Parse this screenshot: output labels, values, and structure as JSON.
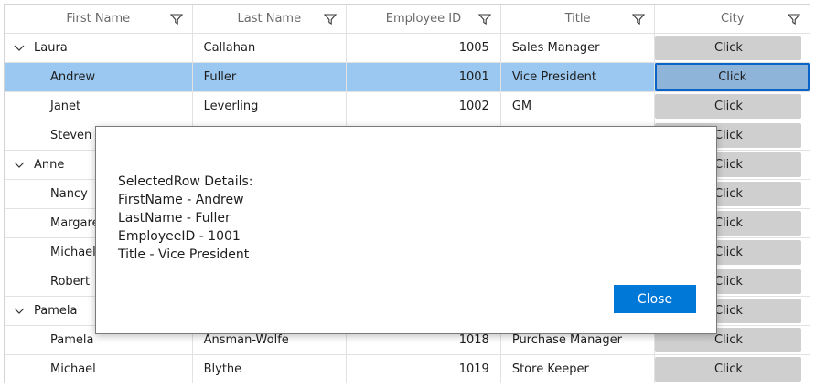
{
  "columns": [
    {
      "label": "First Name"
    },
    {
      "label": "Last Name"
    },
    {
      "label": "Employee ID"
    },
    {
      "label": "Title"
    },
    {
      "label": "City"
    }
  ],
  "rows": [
    {
      "type": "group",
      "first": "Laura",
      "last": "Callahan",
      "id": "1005",
      "title": "Sales Manager",
      "city": "Click"
    },
    {
      "type": "child",
      "first": "Andrew",
      "last": "Fuller",
      "id": "1001",
      "title": "Vice President",
      "city": "Click",
      "selected": true
    },
    {
      "type": "child",
      "first": "Janet",
      "last": "Leverling",
      "id": "1002",
      "title": "GM",
      "city": "Click"
    },
    {
      "type": "child",
      "first": "Steven",
      "last": "",
      "id": "",
      "title": "",
      "city": "Click"
    },
    {
      "type": "group",
      "first": "Anne",
      "last": "",
      "id": "",
      "title": "",
      "city": "Click"
    },
    {
      "type": "child",
      "first": "Nancy",
      "last": "",
      "id": "",
      "title": "",
      "city": "Click"
    },
    {
      "type": "child",
      "first": "Margaret",
      "last": "",
      "id": "",
      "title": "",
      "city": "Click"
    },
    {
      "type": "child",
      "first": "Michael",
      "last": "",
      "id": "",
      "title": "",
      "city": "Click"
    },
    {
      "type": "child",
      "first": "Robert",
      "last": "",
      "id": "",
      "title": "",
      "city": "Click"
    },
    {
      "type": "group",
      "first": "Pamela",
      "last": "",
      "id": "",
      "title": "",
      "city": "Click"
    },
    {
      "type": "child",
      "first": "Pamela",
      "last": "Ansman-Wolfe",
      "id": "1018",
      "title": "Purchase Manager",
      "city": "Click"
    },
    {
      "type": "child",
      "first": "Michael",
      "last": "Blythe",
      "id": "1019",
      "title": "Store Keeper",
      "city": "Click"
    }
  ],
  "dialog": {
    "lines": [
      "SelectedRow Details:",
      "FirstName - Andrew",
      "LastName - Fuller",
      "EmployeeID - 1001",
      "Title - Vice President"
    ],
    "close_label": "Close"
  },
  "colors": {
    "selected_row": "#9bc8f0",
    "accent": "#0078d7",
    "button_bg": "#cfcfcf"
  },
  "icons": {
    "filter": "filter-icon",
    "expander": "chevron-down-icon"
  }
}
